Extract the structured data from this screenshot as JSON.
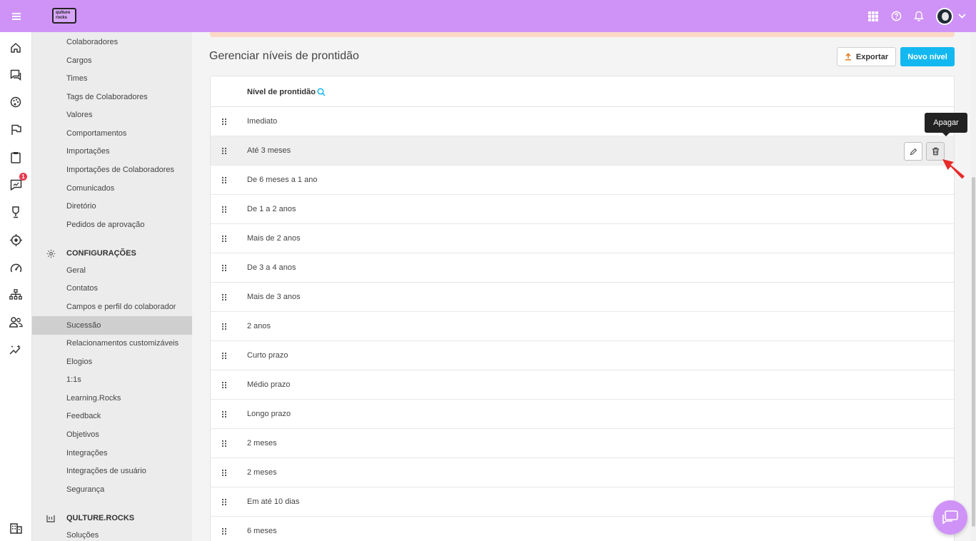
{
  "app": {
    "logo_text": "qulture rocks",
    "accent_color": "#cf93f7",
    "primary_button_color": "#14b8f0"
  },
  "topbar": {
    "icons": [
      "menu-icon",
      "apps-grid-icon",
      "help-icon",
      "bell-icon",
      "avatar",
      "chevron-down-icon"
    ]
  },
  "rail": {
    "icons": [
      "home-icon",
      "chat-icon",
      "palette-icon",
      "flag-icon",
      "clipboard-icon",
      "feedback-icon",
      "trophy-icon",
      "target-icon",
      "gauge-icon",
      "org-chart-icon",
      "people-icon",
      "sparkle-chart-icon",
      "building-icon"
    ],
    "badge_count": "1"
  },
  "menu": {
    "top_items": [
      "Colaboradores",
      "Cargos",
      "Times",
      "Tags de Colaboradores",
      "Valores",
      "Comportamentos",
      "Importações",
      "Importações de Colaboradores",
      "Comunicados",
      "Diretório",
      "Pedidos de aprovação"
    ],
    "config_section": "CONFIGURAÇÕES",
    "config_items": [
      "Geral",
      "Contatos",
      "Campos e perfil do colaborador",
      "Sucessão",
      "Relacionamentos customizáveis",
      "Elogios",
      "1:1s",
      "Learning.Rocks",
      "Feedback",
      "Objetivos",
      "Integrações",
      "Integrações de usuário",
      "Segurança"
    ],
    "active_item": "Sucessão",
    "qr_section": "QULTURE.ROCKS",
    "qr_items": [
      "Soluções"
    ]
  },
  "main": {
    "title": "Gerenciar níveis de prontidão",
    "export_label": "Exportar",
    "new_label": "Novo nível",
    "column_header": "Nível de prontidão",
    "rows": [
      "Imediato",
      "Até 3 meses",
      "De 6 meses a 1 ano",
      "De 1 a 2 anos",
      "Mais de 2 anos",
      "De 3 a 4 anos",
      "Mais de 3 anos",
      "2 anos",
      "Curto prazo",
      "Médio prazo",
      "Longo prazo",
      "2 meses",
      "2 meses",
      "Em até 10 dias",
      "6 meses"
    ],
    "hovered_row": "Até 3 meses",
    "tooltip": "Apagar"
  }
}
